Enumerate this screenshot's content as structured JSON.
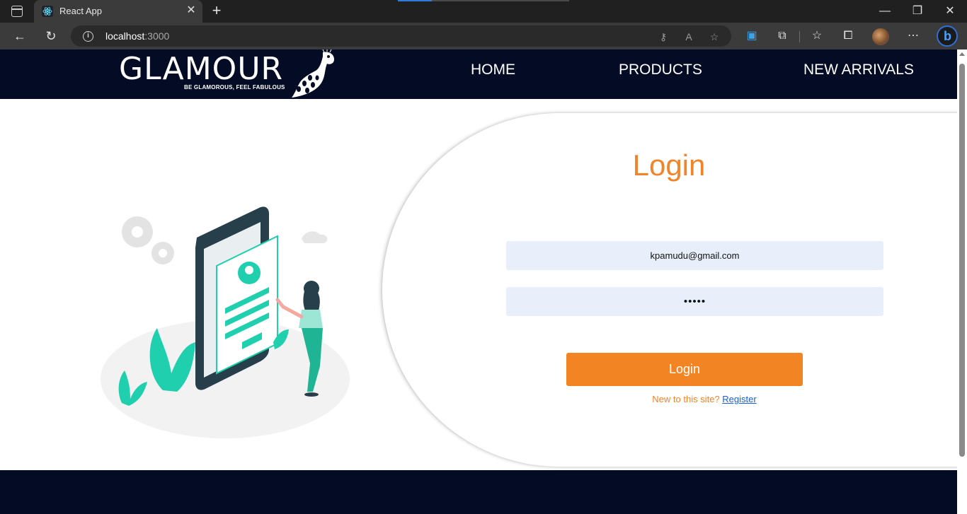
{
  "browser": {
    "tab_title": "React App",
    "url_host": "localhost",
    "url_port": ":3000"
  },
  "header": {
    "logo_text": "GLAMOUR",
    "logo_tagline": "BE GLAMOROUS, FEEL FABULOUS",
    "nav": [
      "HOME",
      "PRODUCTS",
      "NEW ARRIVALS"
    ]
  },
  "login": {
    "title": "Login",
    "email_value": "kpamudu@gmail.com",
    "password_value": "•••••",
    "button_label": "Login",
    "register_prompt": "New to this site?",
    "register_link": "Register"
  },
  "colors": {
    "header_bg": "#040b24",
    "accent": "#f28424",
    "field_bg": "#e8effa"
  }
}
